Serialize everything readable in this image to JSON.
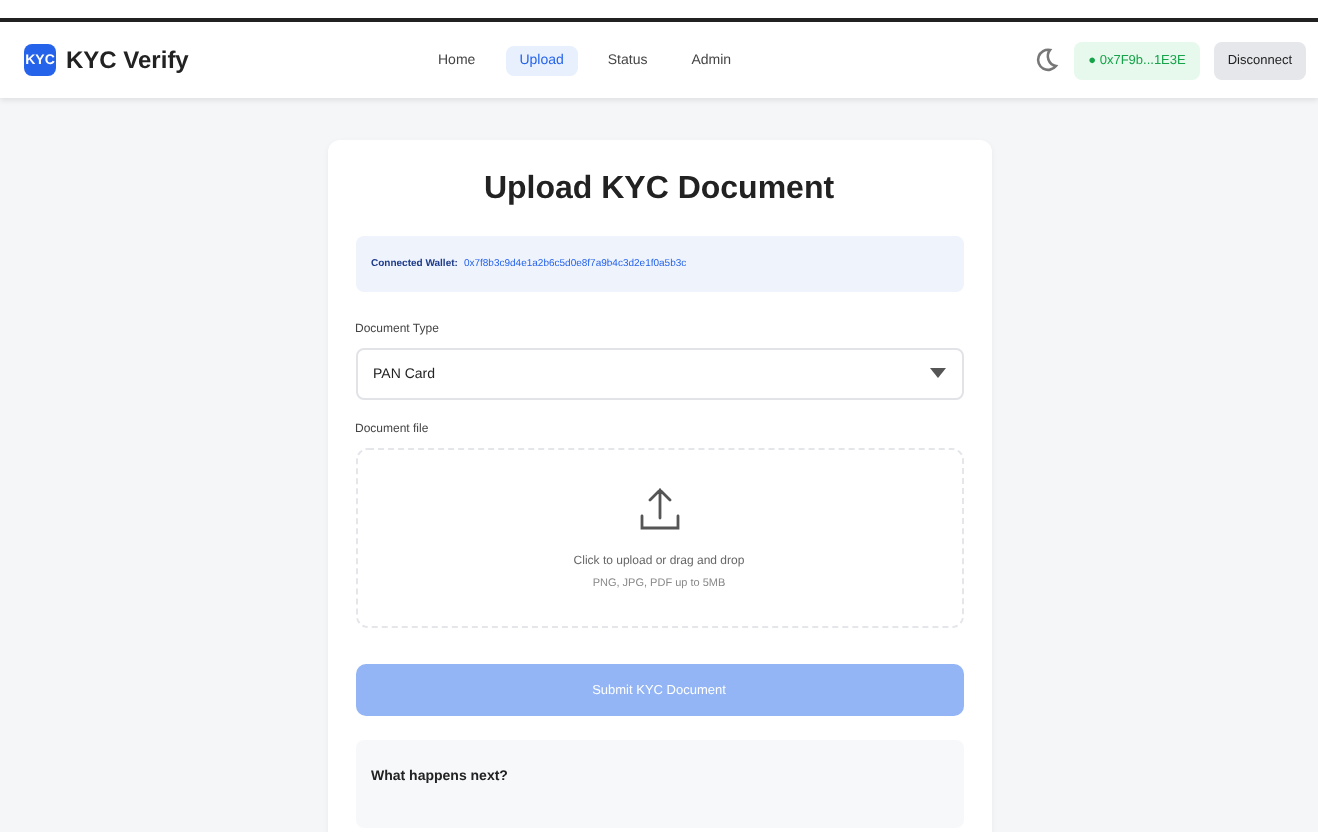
{
  "header": {
    "logo_badge": "KYC",
    "brand": "KYC Verify",
    "nav": [
      {
        "label": "Home",
        "selected": false
      },
      {
        "label": "Upload",
        "selected": true
      },
      {
        "label": "Status",
        "selected": false
      },
      {
        "label": "Admin",
        "selected": false
      }
    ],
    "wallet": "● 0x7F9b...1E3E",
    "disconnect": "Disconnect"
  },
  "card": {
    "title": "Upload KYC Document",
    "wallet_label": "Connected Wallet:",
    "wallet_address": "0x7f8b3c9d4e1a2b6c5d0e8f7a9b4c3d2e1f0a5b3c",
    "doc_type_label": "Document Type",
    "doc_type_value": "PAN Card",
    "doc_file_label": "Document file",
    "drop_text": "Click to upload or drag and drop",
    "drop_hint": "PNG, JPG, PDF up to 5MB",
    "submit": {
      "label": "Submit KYC Document",
      "disabled": true
    },
    "next_title": "What happens next?"
  }
}
